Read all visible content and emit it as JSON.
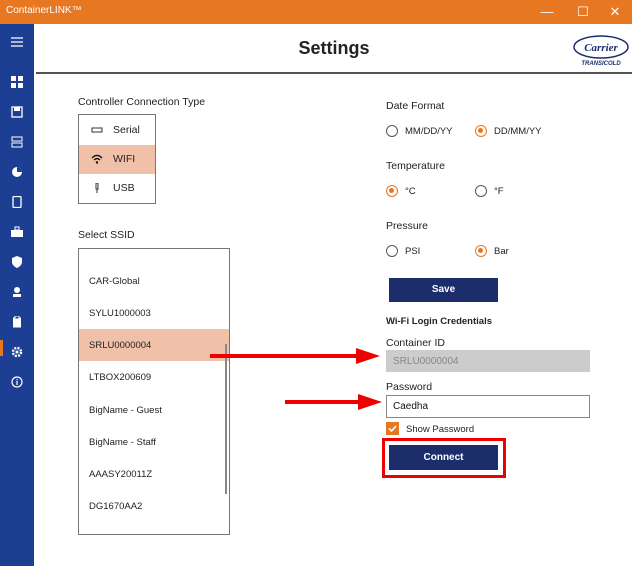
{
  "app": {
    "title": "ContainerLINK™"
  },
  "window_controls": {
    "minimize": "—",
    "maximize": "☐",
    "close": "✕"
  },
  "header": {
    "title": "Settings",
    "logo_text": "Carrier",
    "logo_subtext": "TRANSICOLD"
  },
  "sidebar": {
    "items": [
      {
        "icon": "menu-icon"
      },
      {
        "icon": "dashboard-icon"
      },
      {
        "icon": "save-icon"
      },
      {
        "icon": "storage-icon"
      },
      {
        "icon": "pie-chart-icon"
      },
      {
        "icon": "device-icon"
      },
      {
        "icon": "toolbox-icon"
      },
      {
        "icon": "shield-icon"
      },
      {
        "icon": "user-badge-icon"
      },
      {
        "icon": "clipboard-icon"
      },
      {
        "icon": "gear-icon"
      },
      {
        "icon": "info-icon"
      }
    ],
    "active": "gear-icon"
  },
  "connection": {
    "label": "Controller Connection Type",
    "options": [
      {
        "label": "Serial",
        "icon": "serial-icon"
      },
      {
        "label": "WIFI",
        "icon": "wifi-icon"
      },
      {
        "label": "USB",
        "icon": "usb-icon"
      }
    ],
    "selected": "WIFI"
  },
  "ssid": {
    "label": "Select SSID",
    "items": [
      "CAR-Global",
      "SYLU1000003",
      "SRLU0000004",
      "LTBOX200609",
      "BigName - Guest",
      "BigName - Staff",
      "AAASY20011Z",
      "DG1670AA2"
    ],
    "selected": "SRLU0000004"
  },
  "date_format": {
    "label": "Date Format",
    "options": [
      "MM/DD/YY",
      "DD/MM/YY"
    ],
    "selected": "DD/MM/YY"
  },
  "temperature": {
    "label": "Temperature",
    "options": [
      "°C",
      "°F"
    ],
    "selected": "°C"
  },
  "pressure": {
    "label": "Pressure",
    "options": [
      "PSI",
      "Bar"
    ],
    "selected": "Bar"
  },
  "save_label": "Save",
  "wifi_login": {
    "heading": "Wi-Fi Login Credentials",
    "container_id_label": "Container ID",
    "container_id_value": "SRLU0000004",
    "password_label": "Password",
    "password_value": "Caedha",
    "show_password_label": "Show Password",
    "show_password_checked": true,
    "connect_label": "Connect"
  },
  "colors": {
    "accent": "#e87722",
    "sidebar": "#1c3f94",
    "button": "#1c2d6b",
    "selection": "#f0c0a8",
    "annotation": "#e00000"
  }
}
